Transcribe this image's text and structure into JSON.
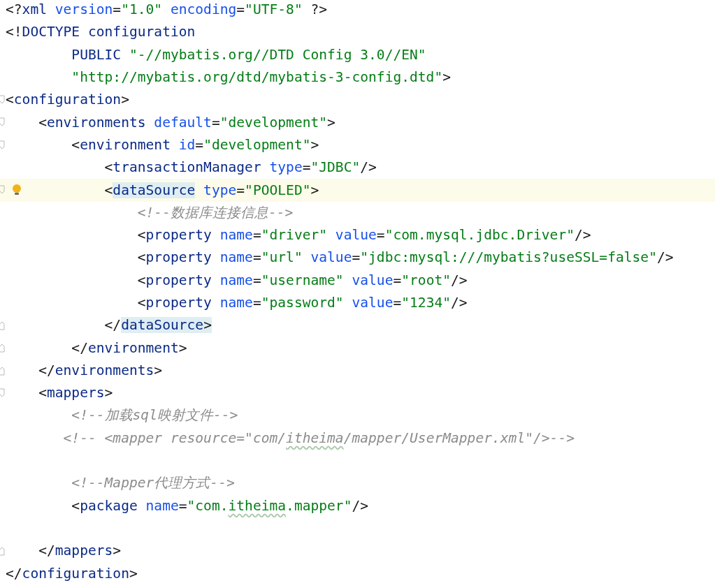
{
  "editor": {
    "lines": [
      {
        "fold_start": false,
        "fold_end": false,
        "tokens": [
          {
            "kind": "punct",
            "text": "<?"
          },
          {
            "kind": "tag",
            "text": "xml"
          },
          {
            "kind": "attr",
            "text": " version"
          },
          {
            "kind": "punct",
            "text": "="
          },
          {
            "kind": "value",
            "text": "\"1.0\""
          },
          {
            "kind": "attr",
            "text": " encoding"
          },
          {
            "kind": "punct",
            "text": "="
          },
          {
            "kind": "value",
            "text": "\"UTF-8\""
          },
          {
            "kind": "punct",
            "text": " ?>"
          }
        ]
      },
      {
        "fold_start": false,
        "fold_end": false,
        "tokens": [
          {
            "kind": "punct",
            "text": "<!"
          },
          {
            "kind": "tag",
            "text": "DOCTYPE configuration"
          }
        ]
      },
      {
        "fold_start": false,
        "fold_end": false,
        "tokens": [
          {
            "kind": "tag",
            "text": "        PUBLIC "
          },
          {
            "kind": "value",
            "text": "\"-//mybatis.org//DTD Config 3.0//EN\""
          }
        ]
      },
      {
        "fold_start": false,
        "fold_end": false,
        "tokens": [
          {
            "kind": "value",
            "text": "        \"http://mybatis.org/dtd/mybatis-3-config.dtd\""
          },
          {
            "kind": "punct",
            "text": ">"
          }
        ]
      },
      {
        "fold_start": true,
        "fold_end": false,
        "tokens": [
          {
            "kind": "punct",
            "text": "<"
          },
          {
            "kind": "tag",
            "text": "configuration"
          },
          {
            "kind": "punct",
            "text": ">"
          }
        ]
      },
      {
        "fold_start": true,
        "fold_end": false,
        "tokens": [
          {
            "kind": "punct",
            "text": "    <"
          },
          {
            "kind": "tag",
            "text": "environments"
          },
          {
            "kind": "attr",
            "text": " default"
          },
          {
            "kind": "punct",
            "text": "="
          },
          {
            "kind": "value",
            "text": "\"development\""
          },
          {
            "kind": "punct",
            "text": ">"
          }
        ]
      },
      {
        "fold_start": true,
        "fold_end": false,
        "tokens": [
          {
            "kind": "punct",
            "text": "        <"
          },
          {
            "kind": "tag",
            "text": "environment"
          },
          {
            "kind": "attr",
            "text": " id"
          },
          {
            "kind": "punct",
            "text": "="
          },
          {
            "kind": "value",
            "text": "\"development\""
          },
          {
            "kind": "punct",
            "text": ">"
          }
        ]
      },
      {
        "fold_start": false,
        "fold_end": false,
        "tokens": [
          {
            "kind": "punct",
            "text": "            <"
          },
          {
            "kind": "tag",
            "text": "transactionManager"
          },
          {
            "kind": "attr",
            "text": " type"
          },
          {
            "kind": "punct",
            "text": "="
          },
          {
            "kind": "value",
            "text": "\"JDBC\""
          },
          {
            "kind": "punct",
            "text": "/>"
          }
        ]
      },
      {
        "fold_start": true,
        "fold_end": false,
        "current": true,
        "hint": true,
        "tokens": [
          {
            "kind": "punct",
            "text": "            <"
          },
          {
            "kind": "tag",
            "text": "dataSource",
            "matched": true
          },
          {
            "kind": "attr",
            "text": " type"
          },
          {
            "kind": "punct",
            "text": "="
          },
          {
            "kind": "value",
            "text": "\"POOLED\""
          },
          {
            "kind": "punct",
            "text": ">"
          }
        ]
      },
      {
        "fold_start": false,
        "fold_end": false,
        "tokens": [
          {
            "kind": "comment",
            "text": "                <!--数据库连接信息-->"
          }
        ]
      },
      {
        "fold_start": false,
        "fold_end": false,
        "tokens": [
          {
            "kind": "punct",
            "text": "                <"
          },
          {
            "kind": "tag",
            "text": "property"
          },
          {
            "kind": "attr",
            "text": " name"
          },
          {
            "kind": "punct",
            "text": "="
          },
          {
            "kind": "value",
            "text": "\"driver\""
          },
          {
            "kind": "attr",
            "text": " value"
          },
          {
            "kind": "punct",
            "text": "="
          },
          {
            "kind": "value",
            "text": "\"com.mysql.jdbc.Driver\""
          },
          {
            "kind": "punct",
            "text": "/>"
          }
        ]
      },
      {
        "fold_start": false,
        "fold_end": false,
        "tokens": [
          {
            "kind": "punct",
            "text": "                <"
          },
          {
            "kind": "tag",
            "text": "property"
          },
          {
            "kind": "attr",
            "text": " name"
          },
          {
            "kind": "punct",
            "text": "="
          },
          {
            "kind": "value",
            "text": "\"url\""
          },
          {
            "kind": "attr",
            "text": " value"
          },
          {
            "kind": "punct",
            "text": "="
          },
          {
            "kind": "value",
            "text": "\"jdbc:mysql:///mybatis?useSSL=false\""
          },
          {
            "kind": "punct",
            "text": "/>"
          }
        ]
      },
      {
        "fold_start": false,
        "fold_end": false,
        "tokens": [
          {
            "kind": "punct",
            "text": "                <"
          },
          {
            "kind": "tag",
            "text": "property"
          },
          {
            "kind": "attr",
            "text": " name"
          },
          {
            "kind": "punct",
            "text": "="
          },
          {
            "kind": "value",
            "text": "\"username\""
          },
          {
            "kind": "attr",
            "text": " value"
          },
          {
            "kind": "punct",
            "text": "="
          },
          {
            "kind": "value",
            "text": "\"root\""
          },
          {
            "kind": "punct",
            "text": "/>"
          }
        ]
      },
      {
        "fold_start": false,
        "fold_end": false,
        "tokens": [
          {
            "kind": "punct",
            "text": "                <"
          },
          {
            "kind": "tag",
            "text": "property"
          },
          {
            "kind": "attr",
            "text": " name"
          },
          {
            "kind": "punct",
            "text": "="
          },
          {
            "kind": "value",
            "text": "\"password\""
          },
          {
            "kind": "attr",
            "text": " value"
          },
          {
            "kind": "punct",
            "text": "="
          },
          {
            "kind": "value",
            "text": "\"1234\""
          },
          {
            "kind": "punct",
            "text": "/>"
          }
        ]
      },
      {
        "fold_start": false,
        "fold_end": true,
        "tokens": [
          {
            "kind": "punct",
            "text": "            </"
          },
          {
            "kind": "tag",
            "text": "dataSource",
            "matched": true
          },
          {
            "kind": "punct",
            "text": ">",
            "matched": true
          }
        ]
      },
      {
        "fold_start": false,
        "fold_end": true,
        "tokens": [
          {
            "kind": "punct",
            "text": "        </"
          },
          {
            "kind": "tag",
            "text": "environment"
          },
          {
            "kind": "punct",
            "text": ">"
          }
        ]
      },
      {
        "fold_start": false,
        "fold_end": true,
        "tokens": [
          {
            "kind": "punct",
            "text": "    </"
          },
          {
            "kind": "tag",
            "text": "environments"
          },
          {
            "kind": "punct",
            "text": ">"
          }
        ]
      },
      {
        "fold_start": true,
        "fold_end": false,
        "tokens": [
          {
            "kind": "punct",
            "text": "    <"
          },
          {
            "kind": "tag",
            "text": "mappers"
          },
          {
            "kind": "punct",
            "text": ">"
          }
        ]
      },
      {
        "fold_start": false,
        "fold_end": false,
        "tokens": [
          {
            "kind": "comment",
            "text": "        <!--加载sql映射文件-->"
          }
        ]
      },
      {
        "fold_start": false,
        "fold_end": false,
        "tokens": [
          {
            "kind": "comment",
            "text": "       <!-- <mapper resource=\"com/"
          },
          {
            "kind": "comment",
            "text": "itheima",
            "typo": true
          },
          {
            "kind": "comment",
            "text": "/mapper/UserMapper.xml\"/>-->"
          }
        ]
      },
      {
        "fold_start": false,
        "fold_end": false,
        "blank": true
      },
      {
        "fold_start": false,
        "fold_end": false,
        "tokens": [
          {
            "kind": "comment",
            "text": "        <!--Mapper代理方式-->"
          }
        ]
      },
      {
        "fold_start": false,
        "fold_end": false,
        "tokens": [
          {
            "kind": "punct",
            "text": "        <"
          },
          {
            "kind": "tag",
            "text": "package"
          },
          {
            "kind": "attr",
            "text": " name"
          },
          {
            "kind": "punct",
            "text": "="
          },
          {
            "kind": "value",
            "text": "\"com."
          },
          {
            "kind": "value",
            "text": "itheima",
            "typo": true
          },
          {
            "kind": "value",
            "text": ".mapper\""
          },
          {
            "kind": "punct",
            "text": "/>"
          }
        ]
      },
      {
        "fold_start": false,
        "fold_end": false,
        "blank": true
      },
      {
        "fold_start": false,
        "fold_end": true,
        "tokens": [
          {
            "kind": "punct",
            "text": "    </"
          },
          {
            "kind": "tag",
            "text": "mappers"
          },
          {
            "kind": "punct",
            "text": ">"
          }
        ]
      },
      {
        "fold_start": false,
        "fold_end": false,
        "tokens": [
          {
            "kind": "punct",
            "text": "</"
          },
          {
            "kind": "tag",
            "text": "configuration"
          },
          {
            "kind": "punct",
            "text": ">"
          }
        ]
      }
    ]
  }
}
